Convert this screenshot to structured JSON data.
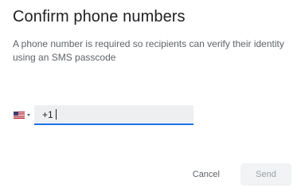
{
  "dialog": {
    "title": "Confirm phone numbers",
    "description": "A phone number is required so recipients can verify their identity using an SMS passcode"
  },
  "phone": {
    "country_icon": "us-flag-icon",
    "dropdown_icon": "caret-down-icon",
    "prefix": "+1",
    "value": "",
    "field_underline_color": "#1a73e8"
  },
  "actions": {
    "cancel_label": "Cancel",
    "send_label": "Send",
    "send_disabled": true
  }
}
